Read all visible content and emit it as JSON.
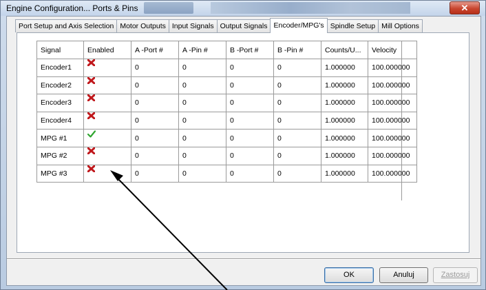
{
  "window": {
    "title": "Engine Configuration... Ports & Pins",
    "close_glyph": "✕"
  },
  "tabs": [
    {
      "label": "Port Setup and Axis Selection",
      "active": false
    },
    {
      "label": "Motor Outputs",
      "active": false
    },
    {
      "label": "Input Signals",
      "active": false
    },
    {
      "label": "Output Signals",
      "active": false
    },
    {
      "label": "Encoder/MPG's",
      "active": true
    },
    {
      "label": "Spindle Setup",
      "active": false
    },
    {
      "label": "Mill Options",
      "active": false
    }
  ],
  "grid": {
    "columns": [
      "Signal",
      "Enabled",
      "A -Port #",
      "A -Pin #",
      "B -Port #",
      "B -Pin #",
      "Counts/U...",
      "Velocity"
    ],
    "rows": [
      {
        "signal": "Encoder1",
        "enabled": false,
        "a_port": "0",
        "a_pin": "0",
        "b_port": "0",
        "b_pin": "0",
        "counts": "1.000000",
        "velocity": "100.000000"
      },
      {
        "signal": "Encoder2",
        "enabled": false,
        "a_port": "0",
        "a_pin": "0",
        "b_port": "0",
        "b_pin": "0",
        "counts": "1.000000",
        "velocity": "100.000000"
      },
      {
        "signal": "Encoder3",
        "enabled": false,
        "a_port": "0",
        "a_pin": "0",
        "b_port": "0",
        "b_pin": "0",
        "counts": "1.000000",
        "velocity": "100.000000"
      },
      {
        "signal": "Encoder4",
        "enabled": false,
        "a_port": "0",
        "a_pin": "0",
        "b_port": "0",
        "b_pin": "0",
        "counts": "1.000000",
        "velocity": "100.000000"
      },
      {
        "signal": "MPG #1",
        "enabled": true,
        "a_port": "0",
        "a_pin": "0",
        "b_port": "0",
        "b_pin": "0",
        "counts": "1.000000",
        "velocity": "100.000000"
      },
      {
        "signal": "MPG #2",
        "enabled": false,
        "a_port": "0",
        "a_pin": "0",
        "b_port": "0",
        "b_pin": "0",
        "counts": "1.000000",
        "velocity": "100.000000"
      },
      {
        "signal": "MPG #3",
        "enabled": false,
        "a_port": "0",
        "a_pin": "0",
        "b_port": "0",
        "b_pin": "0",
        "counts": "1.000000",
        "velocity": "100.000000"
      }
    ]
  },
  "icons": {
    "enabled_true": "green-check-icon",
    "enabled_false": "red-x-icon"
  },
  "colors": {
    "check": "#2fa52f",
    "cross": "#c0181c"
  },
  "buttons": {
    "ok": "OK",
    "cancel": "Anuluj",
    "apply": "Zastosuj"
  }
}
